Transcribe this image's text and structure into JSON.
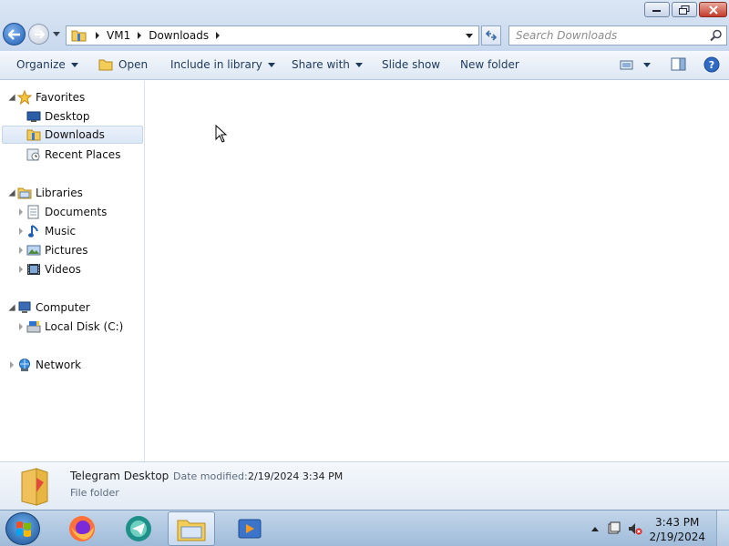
{
  "window": {
    "breadcrumb": [
      "VM1",
      "Downloads"
    ],
    "search_placeholder": "Search Downloads"
  },
  "toolbar": {
    "organize": "Organize",
    "open": "Open",
    "include_in_library": "Include in library",
    "share_with": "Share with",
    "slide_show": "Slide show",
    "new_folder": "New folder"
  },
  "nav": {
    "favorites": "Favorites",
    "desktop": "Desktop",
    "downloads": "Downloads",
    "recent_places": "Recent Places",
    "libraries": "Libraries",
    "documents": "Documents",
    "music": "Music",
    "pictures": "Pictures",
    "videos": "Videos",
    "computer": "Computer",
    "local_disk": "Local Disk (C:)",
    "network": "Network"
  },
  "details": {
    "name": "Telegram Desktop",
    "date_label": "Date modified:",
    "date_value": "2/19/2024 3:34 PM",
    "type": "File folder"
  },
  "taskbar": {
    "time": "3:43 PM",
    "date": "2/19/2024"
  },
  "colors": {
    "accent": "#1e395b",
    "chrome": "#dbe6f4"
  }
}
